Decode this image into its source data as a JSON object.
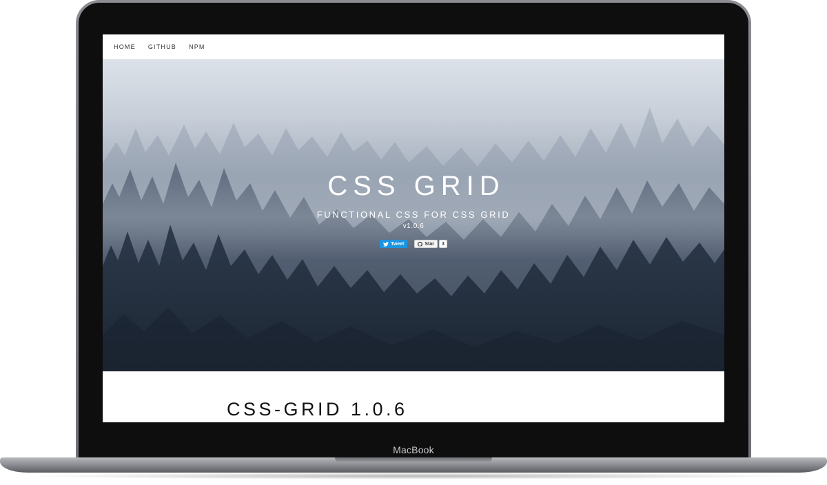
{
  "device": {
    "brand_label": "MacBook"
  },
  "nav": {
    "items": [
      {
        "label": "HOME"
      },
      {
        "label": "GITHUB"
      },
      {
        "label": "NPM"
      }
    ]
  },
  "hero": {
    "title": "CSS GRID",
    "subtitle": "FUNCTIONAL CSS FOR CSS GRID",
    "version": "v1.0.6",
    "tweet_label": "Tweet",
    "star_label": "Star",
    "star_count": "3"
  },
  "content": {
    "heading": "CSS-GRID 1.0.6"
  },
  "colors": {
    "tweet_blue": "#1b95e0",
    "hero_top": "#dde2e9",
    "hero_bottom": "#263242"
  }
}
